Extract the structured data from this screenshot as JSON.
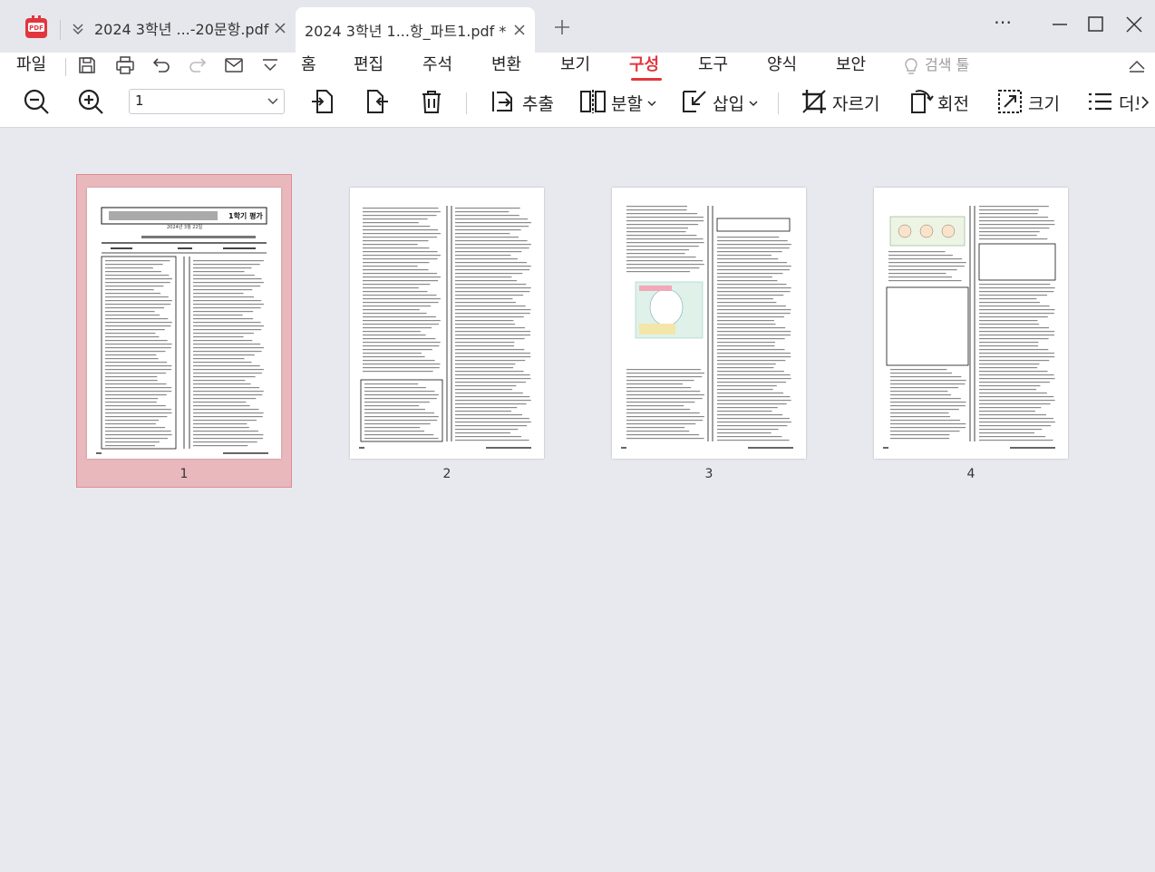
{
  "tabs": [
    {
      "label": "2024  3학년 ...-20문항.pdf",
      "active": false
    },
    {
      "label": "2024  3학년 1...항_파트1.pdf *",
      "active": true
    }
  ],
  "window": {
    "more": "⋯"
  },
  "menu": {
    "file": "파일",
    "items": [
      "홈",
      "편집",
      "주석",
      "변환",
      "보기",
      "구성",
      "도구",
      "양식",
      "보안"
    ],
    "active": "구성",
    "search_tool": "검색 툴"
  },
  "toolbar": {
    "page_value": "1",
    "extract": "추출",
    "split": "분할",
    "insert": "삽입",
    "crop": "자르기",
    "rotate": "회전",
    "size": "크기",
    "more": "더보"
  },
  "pages": [
    {
      "number": "1",
      "selected": true,
      "header_title": "1학기 평가",
      "header_date": "2024년 3월 22일"
    },
    {
      "number": "2",
      "selected": false
    },
    {
      "number": "3",
      "selected": false
    },
    {
      "number": "4",
      "selected": false
    }
  ],
  "colors": {
    "accent": "#e2363d",
    "selection": "#e9b8bc"
  }
}
